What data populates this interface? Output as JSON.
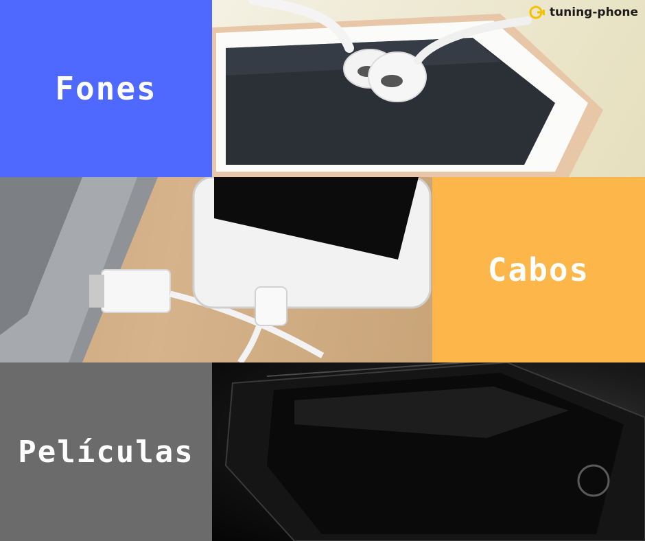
{
  "brand": {
    "name": "tuning-phone",
    "accent": "#f2c200"
  },
  "tiles": {
    "fones": {
      "label": "Fones",
      "color": "#4f68fe"
    },
    "cabos": {
      "label": "Cabos",
      "color": "#fdb64a"
    },
    "peliculas": {
      "label": "Películas",
      "color": "#6b6b6b"
    }
  },
  "icons": {
    "logo": "tuning-phone-logo-icon"
  }
}
